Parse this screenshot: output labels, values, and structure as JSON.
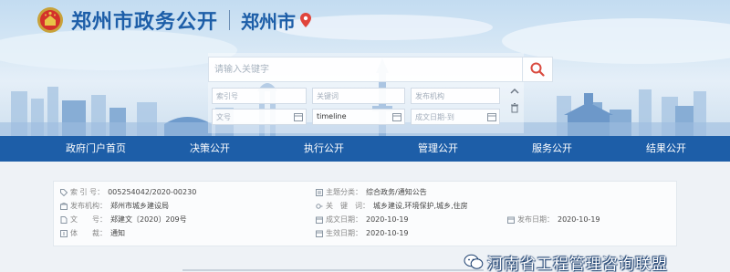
{
  "header": {
    "site_title": "郑州市政务公开",
    "city": "郑州市"
  },
  "search": {
    "placeholder": "请输入关键字",
    "fields": {
      "index_no": "索引号",
      "keyword": "关键词",
      "publisher": "发布机构",
      "doc_no": "文号",
      "timeline": "timeline",
      "date": "成文日期-到"
    }
  },
  "nav": {
    "items": [
      "政府门户首页",
      "决策公开",
      "执行公开",
      "管理公开",
      "服务公开",
      "结果公开"
    ]
  },
  "meta": {
    "index_no": {
      "label": "索 引 号：",
      "value": "005254042/2020-00230"
    },
    "topic": {
      "label": "主题分类：",
      "value": "综合政务/通知公告"
    },
    "publisher": {
      "label": "发布机构：",
      "value": "郑州市城乡建设局"
    },
    "keywords": {
      "label": "关　键　词：",
      "value": "城乡建设,环境保护,城乡,住房"
    },
    "doc_no": {
      "label": "文　　号：",
      "value": "郑建文〔2020〕209号"
    },
    "written_date": {
      "label": "成文日期：",
      "value": "2020-10-19"
    },
    "publish_date": {
      "label": "发布日期：",
      "value": "2020-10-19"
    },
    "doc_type": {
      "label": "体　　裁：",
      "value": "通知"
    },
    "effective_date": {
      "label": "生效日期：",
      "value": "2020-10-19"
    }
  },
  "watermark": {
    "text": "河南省工程管理咨询联盟"
  },
  "colors": {
    "brand_blue": "#1d5ea8",
    "pin_red": "#e0443b",
    "search_icon": "#d94a3f"
  }
}
